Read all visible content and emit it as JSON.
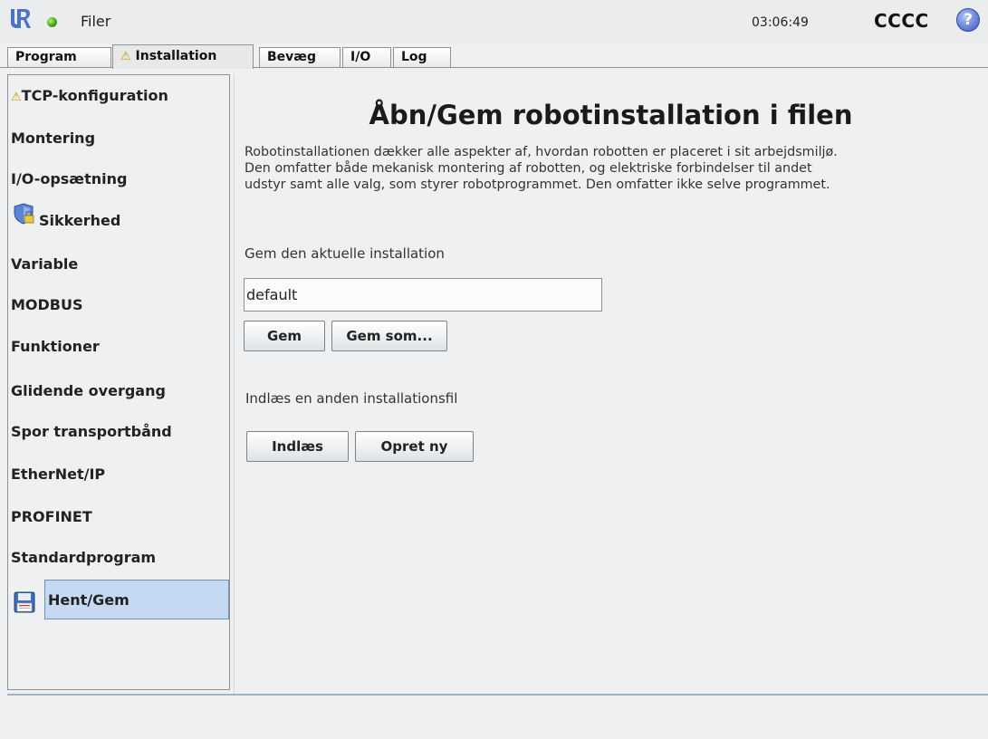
{
  "header": {
    "files_label": "Filer",
    "clock": "03:06:49",
    "robot_name": "CCCC",
    "help_glyph": "?",
    "status_color": "#3fa81d"
  },
  "tabs": [
    {
      "label": "Program",
      "warning": ""
    },
    {
      "label": "Installation",
      "warning": "⚠",
      "active": true
    },
    {
      "label": "Bevæg",
      "warning": ""
    },
    {
      "label": "I/O",
      "warning": ""
    },
    {
      "label": "Log",
      "warning": ""
    }
  ],
  "sidebar": {
    "items": [
      {
        "label": "TCP-konfiguration",
        "warning": "⚠"
      },
      {
        "label": "Montering"
      },
      {
        "label": "I/O-opsætning"
      },
      {
        "label": "Sikkerhed",
        "icon": "shield-icon"
      },
      {
        "label": "Variable"
      },
      {
        "label": "MODBUS"
      },
      {
        "label": "Funktioner"
      },
      {
        "label": "Glidende overgang"
      },
      {
        "label": "Spor transportbånd"
      },
      {
        "label": "EtherNet/IP"
      },
      {
        "label": "PROFINET"
      },
      {
        "label": "Standardprogram"
      },
      {
        "label": "Hent/Gem",
        "icon": "floppy-icon",
        "selected": true
      }
    ],
    "selected_color": "#c5daf2"
  },
  "main": {
    "title": "Åbn/Gem robotinstallation i filen",
    "description": [
      "Robotinstallationen dækker alle aspekter af, hvordan robotten er placeret i sit arbejdsmiljø.",
      "Den omfatter både mekanisk montering af robotten, og elektriske forbindelser til andet",
      "udstyr samt alle valg, som styrer robotprogrammet. Den omfatter ikke selve programmet."
    ],
    "save_heading": "Gem den aktuelle installation",
    "filename_value": "default",
    "save_button": "Gem",
    "save_as_button": "Gem som...",
    "load_heading": "Indlæs en anden installationsfil",
    "load_button": "Indlæs",
    "new_button": "Opret ny"
  }
}
